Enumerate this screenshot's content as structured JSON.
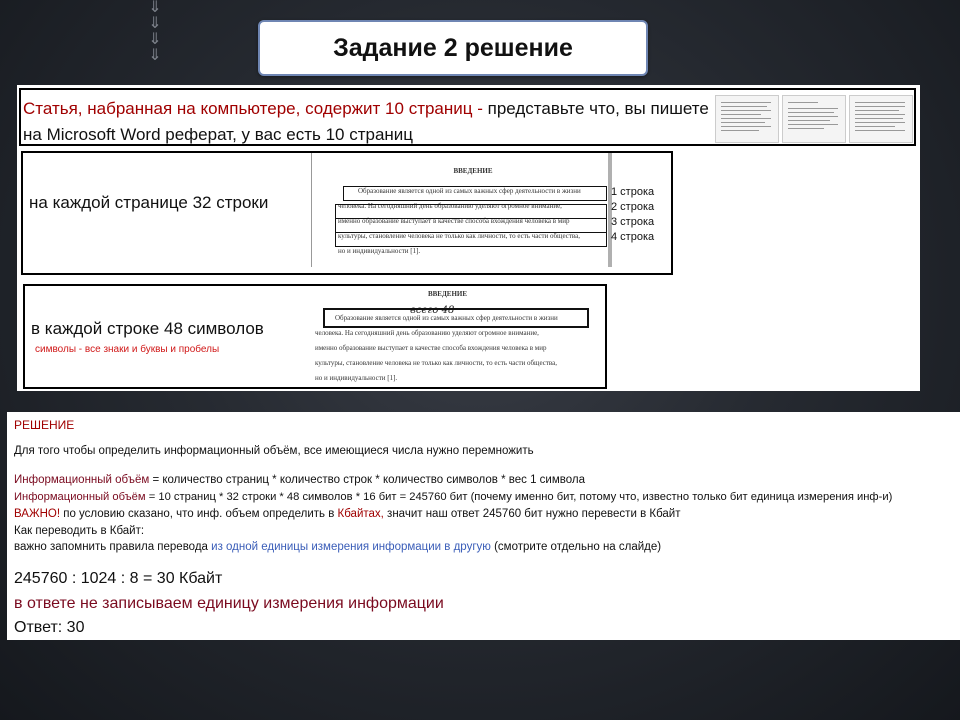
{
  "header": {
    "title": "Задание 2 решение"
  },
  "panel1": {
    "text_red": "Статья, набранная на компьютере, содержит 10 страниц",
    "text_dash": " - ",
    "text_rest": "представьте что, вы пишете на Microsoft Word реферат, у вас есть 10 страниц"
  },
  "panel2": {
    "label": "на каждой странице 32 строки",
    "doc_heading": "ВВЕДЕНИЕ",
    "doc_lines": [
      "Образование является одной из самых важных сфер деятельности в жизни",
      "человека.  На  сегодняшний  день  образованию  уделяют  огромное  внимание,",
      "именно образование выступает в качестве способа вхождения человека в мир",
      "культуры, становление человека не только как личности, то есть части общества,",
      "но и индивидуальности [1]."
    ],
    "row_labels": [
      "1 строка",
      "2 строка",
      "3 строка",
      "4 строка"
    ]
  },
  "panel3": {
    "label": "в каждой строке 48 символов",
    "note": "символы - все знаки и буквы и пробелы",
    "doc_heading": "ВВЕДЕНИЕ",
    "handwriting": "всего 48",
    "doc_lines": [
      "Образование является одной из самых важных сфер деятельности в жизни",
      "человека.  На  сегодняшний  день  образованию  уделяют  огромное  внимание,",
      "именно образование выступает в качестве способа вхождения человека в мир",
      "культуры, становление человека не только как личности, то есть части общества,",
      "но и индивидуальности [1]."
    ]
  },
  "solution": {
    "heading": "РЕШЕНИЕ",
    "intro": "Для того чтобы определить информационный объём, все имеющиеся числа нужно перемножить",
    "formula_term": "Информационный объём",
    "formula_rest": " = количество страниц * количество строк * количество символов * вес 1 символа",
    "calc_term": "Информационный объём",
    "calc_rest": "  = 10 страниц * 32 строки * 48 символов * 16 бит = 245760 бит (почему именно бит, потому что, известно только бит единица измерения инф-и)",
    "important_label": "ВАЖНО!",
    "important_mid": " по условию сказано, что инф. объем определить в ",
    "important_unit": "Кбайтах,",
    "important_end": " значит наш ответ 245760 бит нужно перевести в Кбайт",
    "convert_q": "Как переводить в Кбайт:",
    "rule_start": "важно запомнить правила перевода ",
    "rule_link": "из одной единицы измерения информации в другую",
    "rule_end": " (смотрите отдельно на слайде)",
    "result": "245760 : 1024 : 8 = 30 Кбайт",
    "no_unit": "в ответе не записываем единицу измерения информации",
    "answer": "Ответ: 30"
  },
  "colors": {
    "accent_red": "#a00000",
    "term_color": "#7a0a1f",
    "link_blue": "#3a5db8",
    "title_border": "#6f86b3"
  }
}
